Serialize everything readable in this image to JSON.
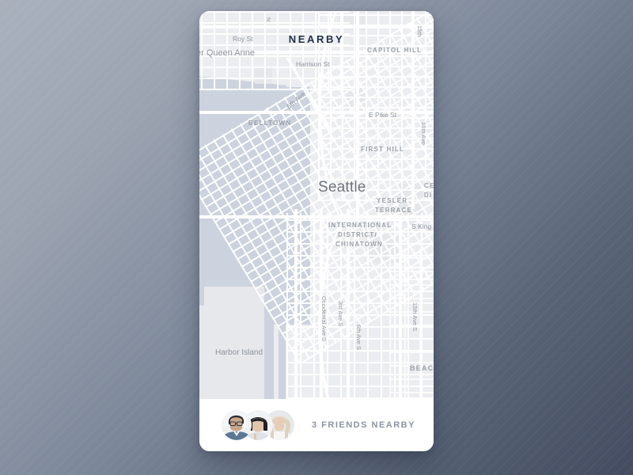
{
  "app": {
    "logo_text": "NEARBY",
    "logo_color": "#1e2f4a"
  },
  "map": {
    "city_label": "Seattle",
    "neighborhoods": [
      {
        "name": "CAPITOL HILL"
      },
      {
        "name": "BELLTOWN"
      },
      {
        "name": "FIRST HILL"
      },
      {
        "name": "YESLER TERRACE"
      },
      {
        "name": "INTERNATIONAL DISTRICT/ CHINATOWN"
      },
      {
        "name": "BEACO"
      },
      {
        "name": "CE DI"
      }
    ],
    "hood_capitol_hill": "CAPITOL HILL",
    "hood_belltown": "BELLTOWN",
    "hood_first_hill": "FIRST HILL",
    "hood_yesler_1": "YESLER",
    "hood_yesler_2": "TERRACE",
    "hood_intl_1": "INTERNATIONAL",
    "hood_intl_2": "DISTRICT/",
    "hood_intl_3": "CHINATOWN",
    "hood_beacon": "BEACO",
    "hood_central_1": "CE",
    "hood_central_2": "DI",
    "streets": {
      "roy_st": "Roy St",
      "lower_queen_anne": "er Queen Anne",
      "harrison_st": "Harrison St",
      "sixth_ave": "6th Ave",
      "e_pike_st": "E Pike St",
      "sixteenth_ave": "16th Ave",
      "fifteenth_top": "15th",
      "s_king": "S King",
      "occidental_ave_s": "Occidental Ave S",
      "third_ave_s": "3rd Ave S",
      "sixth_ave_s": "6th Ave S",
      "fifteenth_ave_s": "15th Ave S",
      "queen_anne_n": "N"
    },
    "places": {
      "harbor_island": "Harbor Island"
    },
    "colors": {
      "land": "#ecedf0",
      "water": "#ccd3de",
      "road": "#ffffff",
      "label": "#8d939c"
    }
  },
  "bottom_bar": {
    "friends_label": "3 FRIENDS NEARBY",
    "friend_count": 3,
    "avatars": [
      {
        "name": "friend-avatar-1"
      },
      {
        "name": "friend-avatar-2"
      },
      {
        "name": "friend-avatar-3"
      }
    ]
  }
}
